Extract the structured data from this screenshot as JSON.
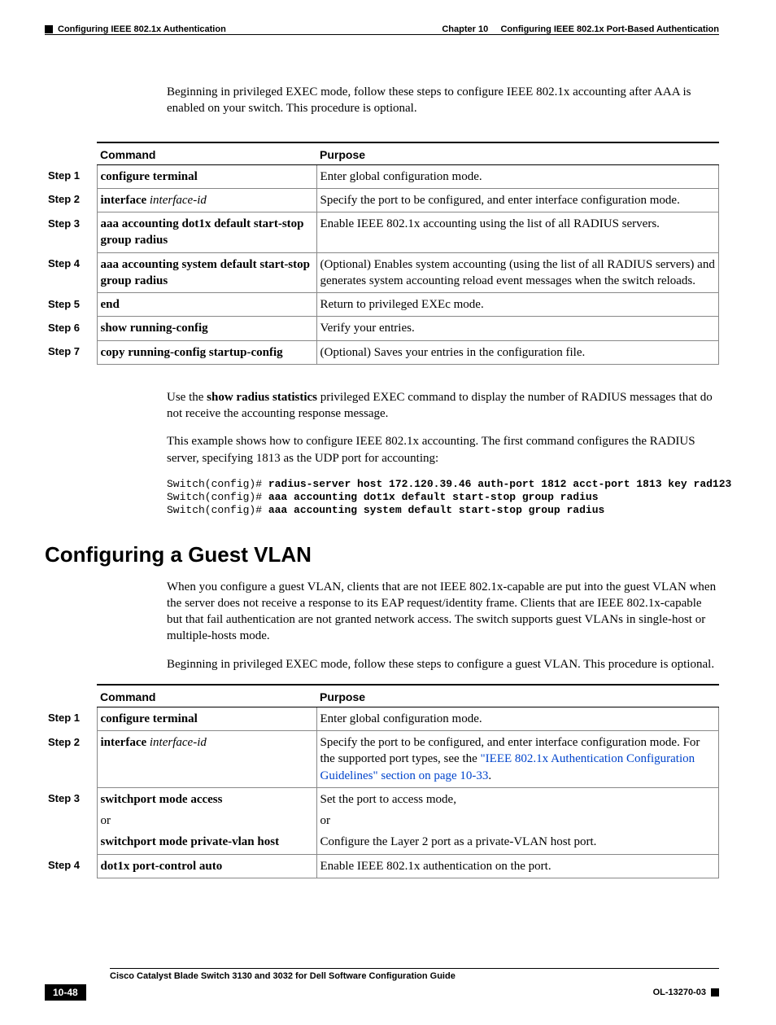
{
  "header": {
    "left": "Configuring IEEE 802.1x Authentication",
    "right_chapter": "Chapter 10",
    "right_title": "Configuring IEEE 802.1x Port-Based Authentication"
  },
  "intro_para": "Beginning in privileged EXEC mode, follow these steps to configure IEEE 802.1x accounting after AAA is enabled on your switch. This procedure is optional.",
  "table1": {
    "head_command": "Command",
    "head_purpose": "Purpose",
    "rows": [
      {
        "step": "Step 1",
        "cmd_bold": "configure terminal",
        "cmd_italic": "",
        "purpose": "Enter global configuration mode."
      },
      {
        "step": "Step 2",
        "cmd_bold": "interface",
        "cmd_italic": " interface-id",
        "purpose": "Specify the port to be configured, and enter interface configuration mode."
      },
      {
        "step": "Step 3",
        "cmd_bold": "aaa accounting dot1x default start-stop group radius",
        "cmd_italic": "",
        "purpose": "Enable IEEE 802.1x accounting using the list of all RADIUS servers."
      },
      {
        "step": "Step 4",
        "cmd_bold": "aaa accounting system default start-stop group radius",
        "cmd_italic": "",
        "purpose": "(Optional) Enables system accounting (using the list of all RADIUS servers) and generates system accounting reload event messages when the switch reloads."
      },
      {
        "step": "Step 5",
        "cmd_bold": "end",
        "cmd_italic": "",
        "purpose": "Return to privileged EXEc mode."
      },
      {
        "step": "Step 6",
        "cmd_bold": "show running-config",
        "cmd_italic": "",
        "purpose": "Verify your entries."
      },
      {
        "step": "Step 7",
        "cmd_bold": "copy running-config startup-config",
        "cmd_italic": "",
        "purpose": "(Optional) Saves your entries in the configuration file."
      }
    ]
  },
  "para_after_table1_pre": "Use the ",
  "para_after_table1_bold": "show radius statistics",
  "para_after_table1_post": " privileged EXEC command to display the number of RADIUS messages that do not receive the accounting response message.",
  "para_example_intro": "This example shows how to configure IEEE 802.1x accounting. The first command configures the RADIUS server, specifying 1813 as the UDP port for accounting:",
  "code": {
    "l1_pre": "Switch(config)# ",
    "l1_bold": "radius-server host 172.120.39.46 auth-port 1812 acct-port 1813 key rad123",
    "l2_pre": "Switch(config)# ",
    "l2_bold": "aaa accounting dot1x default start-stop group radius",
    "l3_pre": "Switch(config)# ",
    "l3_bold": "aaa accounting system default start-stop group radius"
  },
  "section_title": "Configuring a Guest VLAN",
  "guest_para1": "When you configure a guest VLAN, clients that are not IEEE 802.1x-capable are put into the guest VLAN when the server does not receive a response to its EAP request/identity frame. Clients that are IEEE 802.1x-capable but that fail authentication are not granted network access. The switch supports guest VLANs in single-host or multiple-hosts mode.",
  "guest_para2": "Beginning in privileged EXEC mode, follow these steps to configure a guest VLAN. This procedure is optional.",
  "table2": {
    "head_command": "Command",
    "head_purpose": "Purpose",
    "r1": {
      "step": "Step 1",
      "cmd_bold": "configure terminal",
      "purpose": "Enter global configuration mode."
    },
    "r2": {
      "step": "Step 2",
      "cmd_bold": "interface",
      "cmd_italic": " interface-id",
      "purpose_pre": "Specify the port to be configured, and enter interface configuration mode. For the supported port types, see the ",
      "purpose_link": "\"IEEE 802.1x Authentication Configuration Guidelines\" section on page 10-33",
      "purpose_post": "."
    },
    "r3": {
      "step": "Step 3",
      "cmd_line1_bold": "switchport mode access",
      "cmd_or": "or",
      "cmd_line2_bold": "switchport mode private-vlan host",
      "purpose_line1": "Set the port to access mode,",
      "purpose_or": "or",
      "purpose_line2": "Configure the Layer 2 port as a private-VLAN host port."
    },
    "r4": {
      "step": "Step 4",
      "cmd_bold": "dot1x port-control auto",
      "purpose": "Enable IEEE 802.1x authentication on the port."
    }
  },
  "footer": {
    "title": "Cisco Catalyst Blade Switch 3130 and 3032 for Dell Software Configuration Guide",
    "page": "10-48",
    "docid": "OL-13270-03"
  }
}
